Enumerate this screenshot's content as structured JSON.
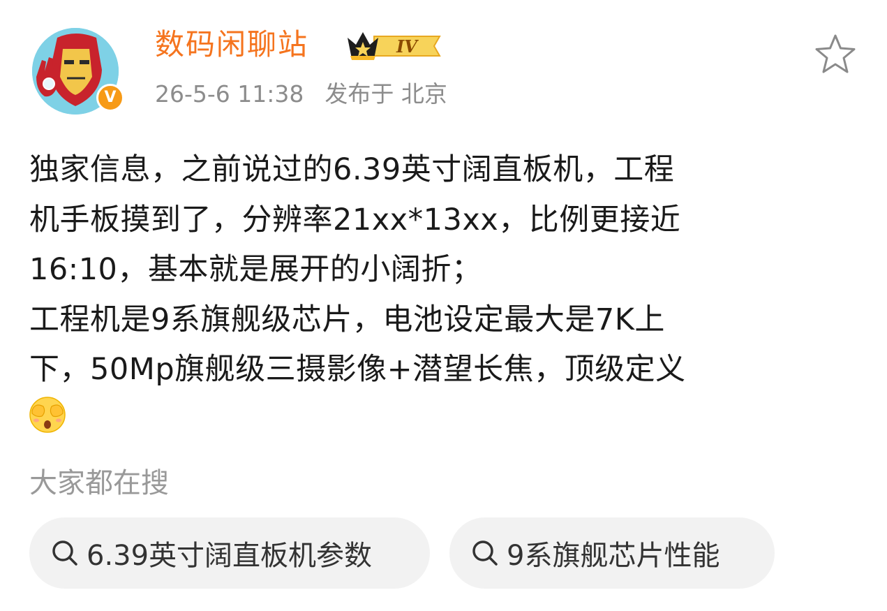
{
  "post": {
    "author": {
      "name": "数码闲聊站",
      "level_badge": "IV",
      "verified_mark": "V",
      "avatar_icon": "iron-man-avatar",
      "crown_icon": "crown-icon"
    },
    "timestamp": "26-5-6 11:38",
    "location": "发布于 北京",
    "favorite_icon": "star-outline-icon",
    "content_lines": [
      "独家信息，之前说过的6.39英寸阔直板机，工程",
      "机手板摸到了，分辨率21xx*13xx，比例更接近",
      "16:10，基本就是展开的小阔折；",
      "工程机是9系旗舰级芯片，电池设定最大是7K上",
      "下，50Mp旗舰级三摄影像+潜望长焦，顶级定义"
    ],
    "emoji": "face-covering-eyes-emoji"
  },
  "search_section": {
    "title": "大家都在搜",
    "chips": [
      {
        "label": "6.39英寸阔直板机参数",
        "icon": "search-icon"
      },
      {
        "label": "9系旗舰芯片性能",
        "icon": "search-icon"
      }
    ]
  },
  "colors": {
    "name_orange": "#f5741e",
    "meta_gray": "#8c8c8c",
    "chip_bg": "#f2f2f2",
    "badge_gold": "#f7b928"
  }
}
